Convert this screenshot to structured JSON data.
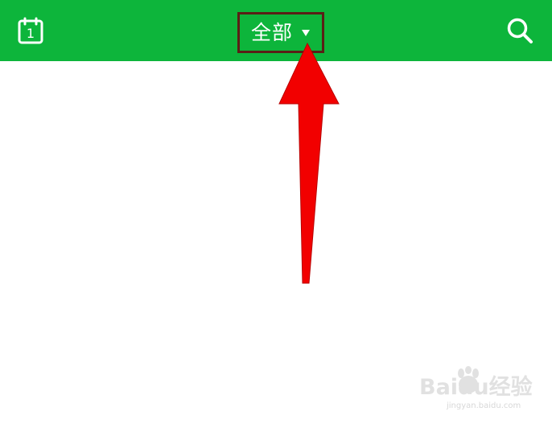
{
  "top_bar": {
    "background_color": "#0db53b",
    "calendar_day": "1",
    "calendar_icon": "calendar-icon",
    "filter_label": "全部",
    "dropdown_icon": "caret-down-icon",
    "search_icon": "search-icon"
  },
  "annotation": {
    "highlight_color": "#5a1f16",
    "arrow_color": "#f20000"
  },
  "watermark": {
    "brand_text": "Baidu经验",
    "domain": "jingyan.baidu.com",
    "logo_icon": "baidu-paw-icon"
  }
}
